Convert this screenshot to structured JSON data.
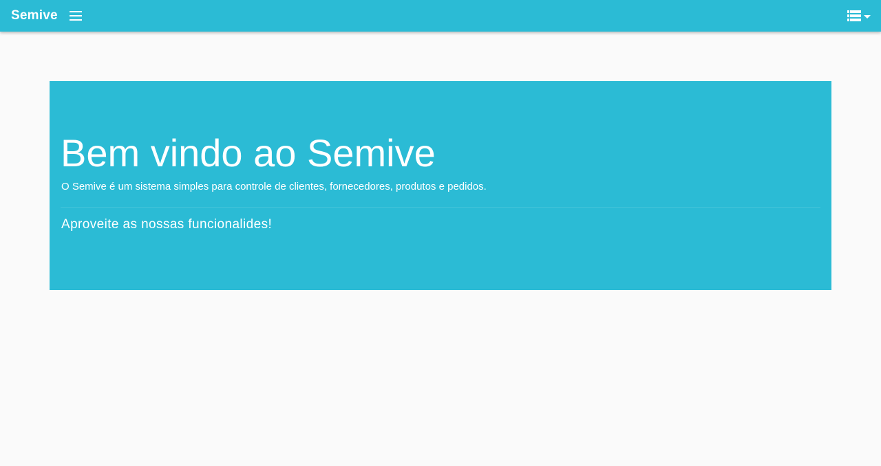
{
  "navbar": {
    "brand": "Semive",
    "menu_icon": "hamburger-menu-icon",
    "right_icon": "list-view-icon",
    "dropdown_icon": "caret-down-icon",
    "color": "#2bbbd5"
  },
  "jumbotron": {
    "title": "Bem vindo ao Semive",
    "lead": "O Semive é um sistema simples para controle de clientes, fornecedores, produtos e pedidos.",
    "subtitle": "Aproveite as nossas funcionalides!",
    "color": "#2bbbd5"
  },
  "page": {
    "background": "#fafafa"
  }
}
